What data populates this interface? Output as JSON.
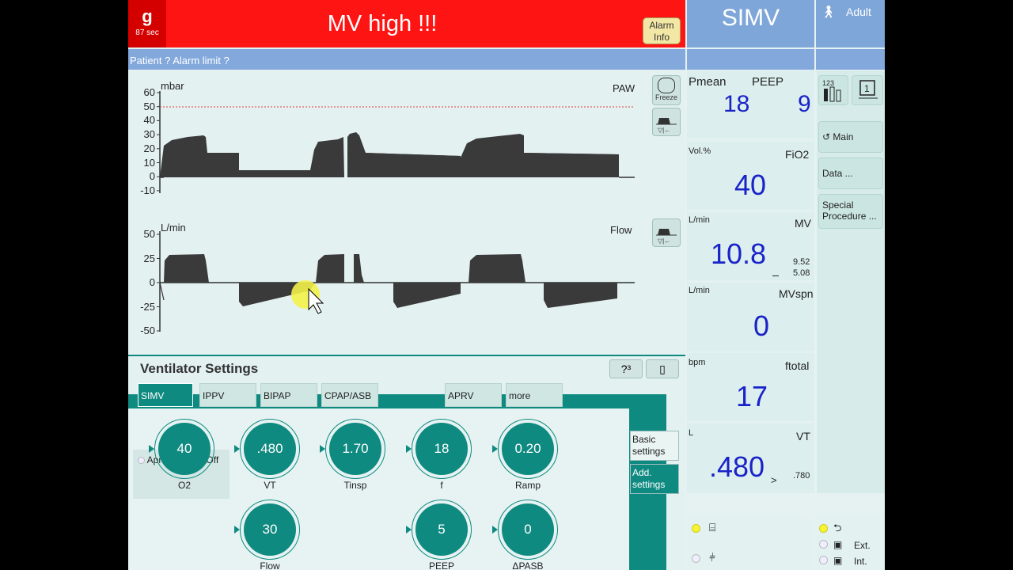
{
  "alarm": {
    "code_letter": "g",
    "code_seconds": "87 sec",
    "message": "MV high !!!",
    "info_button": "Alarm Info",
    "subtext": "Patient ? Alarm limit ?"
  },
  "mode": "SIMV",
  "patient": {
    "icon": "person-icon",
    "type": "Adult"
  },
  "paw_chart": {
    "unit": "mbar",
    "name": "PAW",
    "ticks": [
      "60",
      "50",
      "40",
      "30",
      "20",
      "10",
      "0",
      "-10"
    ],
    "freeze_label": "Freeze"
  },
  "flow_chart": {
    "unit": "L/min",
    "name": "Flow",
    "ticks": [
      "50",
      "25",
      "0",
      "-25",
      "-50"
    ]
  },
  "measurements": {
    "pmean": {
      "label": "Pmean",
      "value": "18"
    },
    "peep": {
      "label": "PEEP",
      "value": "9"
    },
    "fio2": {
      "unit": "Vol.%",
      "label": "FiO2",
      "value": "40"
    },
    "mv": {
      "unit": "L/min",
      "label": "MV",
      "value": "10.8",
      "upper": "9.52",
      "lower": "5.08"
    },
    "mvspn": {
      "unit": "L/min",
      "label": "MVspn",
      "value": "0"
    },
    "ftotal": {
      "unit": "bpm",
      "label": "ftotal",
      "value": "17"
    },
    "vt": {
      "unit": "L",
      "label": "VT",
      "value": ".480",
      "limit": ".780"
    }
  },
  "menu": {
    "main": "Main",
    "data": "Data ...",
    "special": "Special Procedure ..."
  },
  "settings": {
    "title": "Ventilator Settings",
    "help": "?³",
    "blank": "▯",
    "tabs": [
      "SIMV",
      "IPPV",
      "BIPAP",
      "CPAP/ASB",
      "APRV",
      "more"
    ],
    "side_tabs": [
      "Basic settings",
      "Add. settings"
    ],
    "apnoea": "Apnoea-vent. Off",
    "dials": [
      {
        "label": "O2",
        "value": "40"
      },
      {
        "label": "VT",
        "value": ".480"
      },
      {
        "label": "Tinsp",
        "value": "1.70"
      },
      {
        "label": "f",
        "value": "18"
      },
      {
        "label": "Ramp",
        "value": "0.20"
      },
      {
        "label": "Flow",
        "value": "30"
      },
      {
        "label": "PEEP",
        "value": "5"
      },
      {
        "label": "ΔPASB",
        "value": "0"
      }
    ]
  },
  "status": {
    "ext": "Ext.",
    "int": "Int."
  }
}
